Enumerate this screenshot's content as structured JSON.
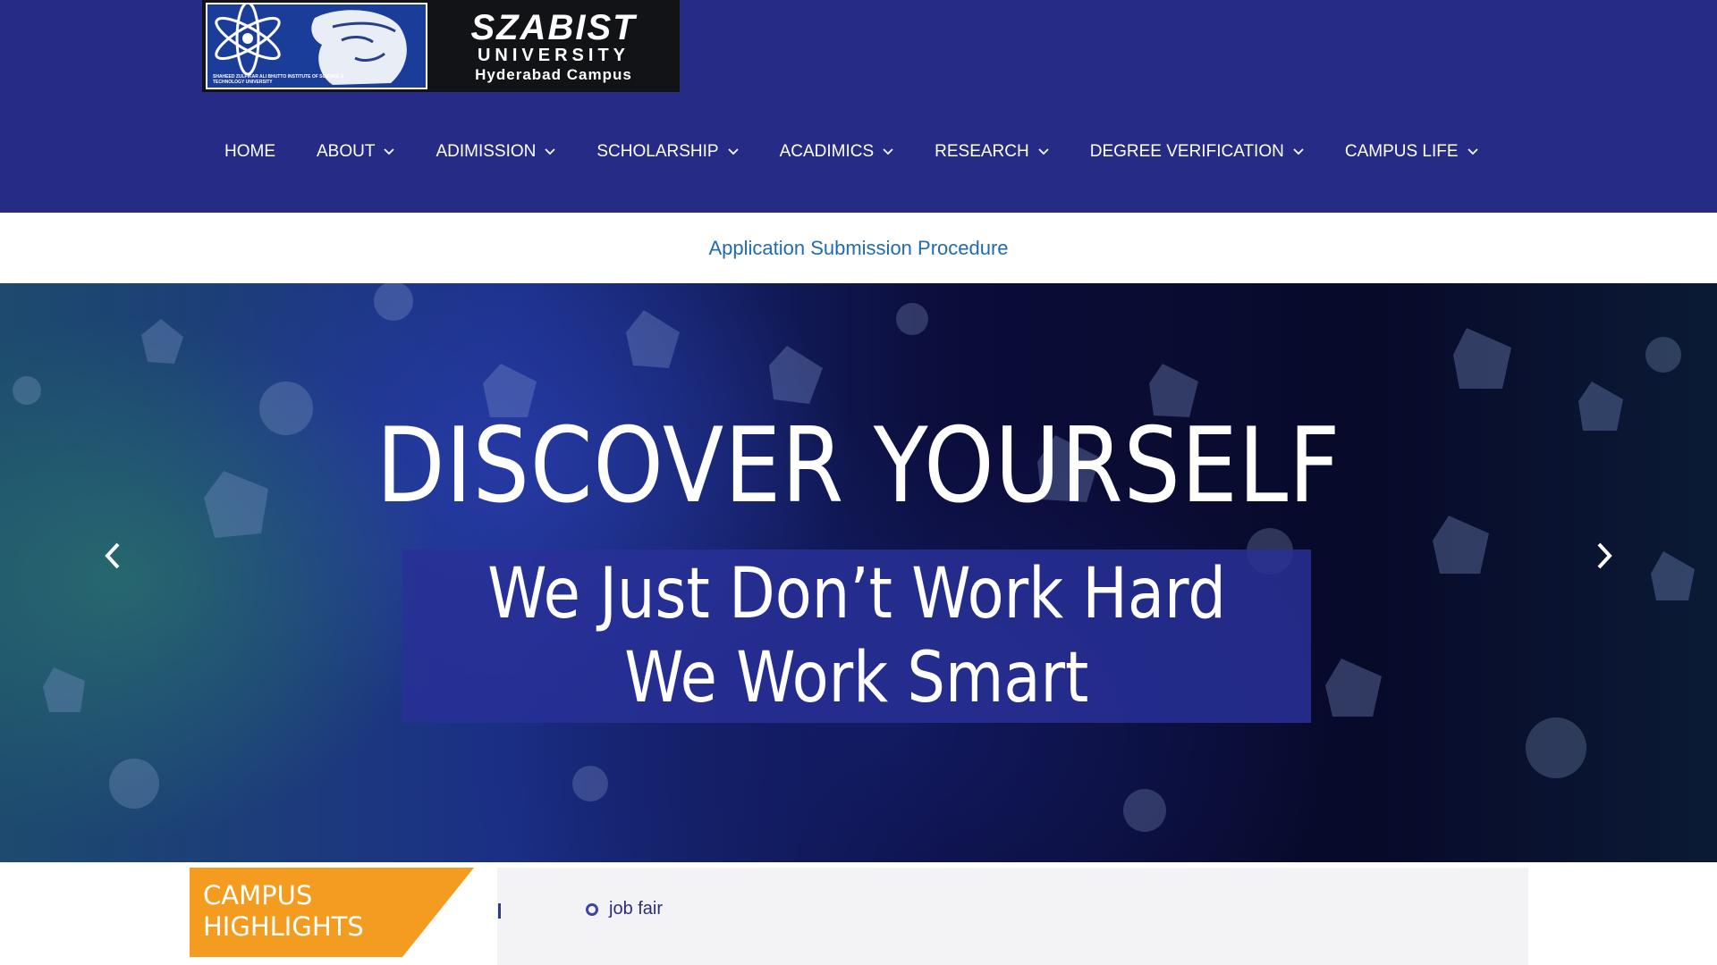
{
  "brand": {
    "name": "SZABIST",
    "line2": "UNIVERSITY",
    "line3": "Hyderabad Campus",
    "emblem_caption": "SHAHEED ZULFIKAR ALI BHUTTO INSTITUTE OF SCIENCE & TECHNOLOGY UNIVERSITY",
    "colors": {
      "header_bg": "#262c86",
      "accent_orange": "#f39c1f",
      "link_blue": "#1f6bb0"
    }
  },
  "nav": {
    "items": [
      {
        "label": "HOME",
        "has_dropdown": false
      },
      {
        "label": "ABOUT",
        "has_dropdown": true
      },
      {
        "label": "ADIMISSION",
        "has_dropdown": true
      },
      {
        "label": "SCHOLARSHIP",
        "has_dropdown": true
      },
      {
        "label": "ACADIMICS",
        "has_dropdown": true
      },
      {
        "label": "RESEARCH",
        "has_dropdown": true
      },
      {
        "label": "DEGREE VERIFICATION",
        "has_dropdown": true
      },
      {
        "label": "CAMPUS LIFE",
        "has_dropdown": true
      }
    ]
  },
  "notice": {
    "link_text": "Application Submission Procedure"
  },
  "hero": {
    "title": "DISCOVER YOURSELF",
    "subtitle_line1": "We Just Don’t Work Hard",
    "subtitle_line2": "We Work Smart",
    "prev_icon": "chevron-left-icon",
    "next_icon": "chevron-right-icon"
  },
  "highlights": {
    "label_line1": "CAMPUS",
    "label_line2": "HIGHLIGHTS",
    "ticker_fragment": "l",
    "ticker_item": "job fair"
  }
}
